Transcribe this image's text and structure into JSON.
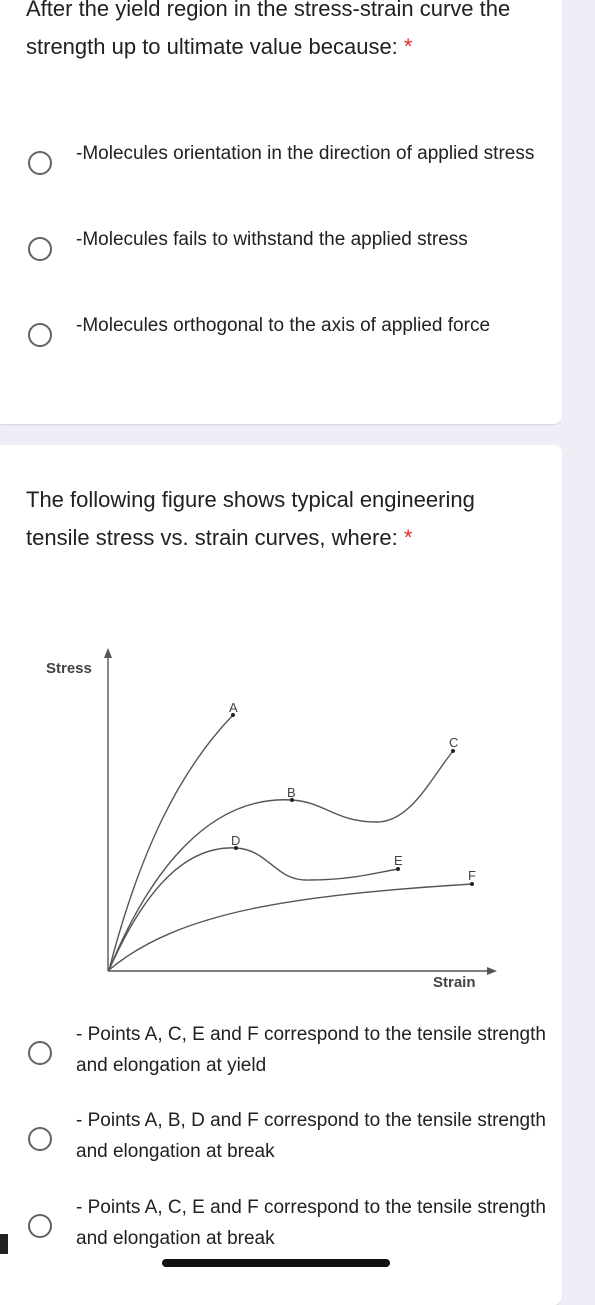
{
  "question1": {
    "title": "After the yield region in the stress-strain curve the strength up to ultimate value because:",
    "required_mark": "*",
    "options": [
      {
        "label": "-Molecules orientation in the direction of applied stress",
        "selected": false
      },
      {
        "label": "-Molecules fails to withstand the applied stress",
        "selected": false
      },
      {
        "label": "-Molecules orthogonal to the axis of applied force",
        "selected": false
      }
    ]
  },
  "question2": {
    "title": "The following figure shows typical engineering tensile stress vs. strain curves, where:",
    "required_mark": "*",
    "figure": {
      "y_label": "Stress",
      "x_label": "Strain",
      "points": [
        "A",
        "B",
        "C",
        "D",
        "E",
        "F"
      ]
    },
    "options": [
      {
        "label": "- Points A, C, E and F correspond to the tensile strength and elongation at yield",
        "selected": false
      },
      {
        "label": "- Points A, B, D and F correspond to the tensile strength and elongation at break",
        "selected": false
      },
      {
        "label": "- Points A, C, E and F correspond to the tensile strength and elongation at break",
        "selected": false
      }
    ]
  }
}
